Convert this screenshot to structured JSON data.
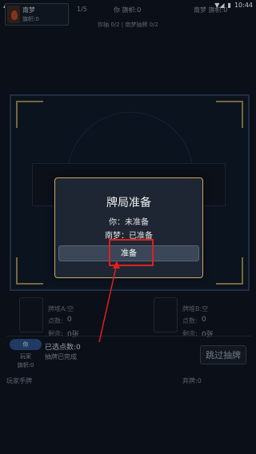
{
  "statusbar": {
    "left_icons": "▲ ▲",
    "time": "10:44",
    "signal": "▼◢",
    "battery": "▮"
  },
  "header": {
    "player_name": "南梦",
    "player_flags": "旗帜:0",
    "round_count": "1/5",
    "you_flags": "你 旗帜:0",
    "opp_flags": "南梦 旗帜:0",
    "draws": "你抽 0/2 | 南梦抽牌 0/2"
  },
  "dialog": {
    "title": "牌局准备",
    "you_status": "你：未准备",
    "opp_status": "南梦：已准备",
    "ready_label": "准备"
  },
  "lower": {
    "slot_a": {
      "label": "牌堆A:空",
      "points_label": "点数:",
      "points": "0",
      "cards_label": "剩余:",
      "cards": "0张"
    },
    "slot_b": {
      "label": "牌堆B:空",
      "points_label": "点数:",
      "points": "0",
      "cards_label": "剩余:",
      "cards": "0张"
    },
    "you_badge": "你",
    "player_label": "玩家",
    "player_flags": "旗帜:0",
    "selected_points": "已选点数:0",
    "draw_done": "抽牌已完成",
    "skip_label": "跳过抽牌",
    "hand_label": "玩家手牌",
    "discard_label": "弃牌:0"
  },
  "colors": {
    "accent_gold": "#c8a96a",
    "highlight_red": "#e0201c",
    "badge_blue": "#2a4e84"
  }
}
